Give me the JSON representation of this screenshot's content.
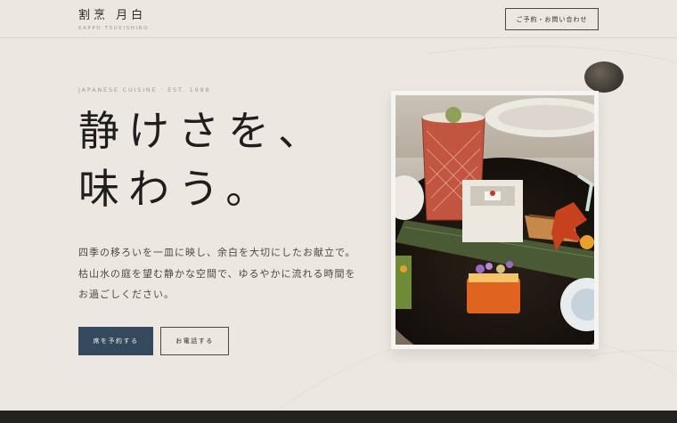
{
  "header": {
    "logo_name": "割烹 月白",
    "logo_sub": "KAPPO TSUKISHIRO",
    "cta_label": "ご予約・お問い合わせ"
  },
  "hero": {
    "eyebrow": "JAPANESE CUISINE · EST. 1998",
    "headline_line1": "静けさを、",
    "headline_line2": "味わう。",
    "desc_line1": "四季の移ろいを一皿に映し、余白を大切にしたお献立で。",
    "desc_line2": "枯山水の庭を望む静かな空間で、ゆるやかに流れる時間を",
    "desc_line3": "お過ごしください。",
    "primary_button": "席を予約する",
    "secondary_button": "お電話する"
  },
  "colors": {
    "background": "#ece8e1",
    "primary_button": "#34495e",
    "text": "#1f1e1c",
    "footer": "#24221f"
  }
}
